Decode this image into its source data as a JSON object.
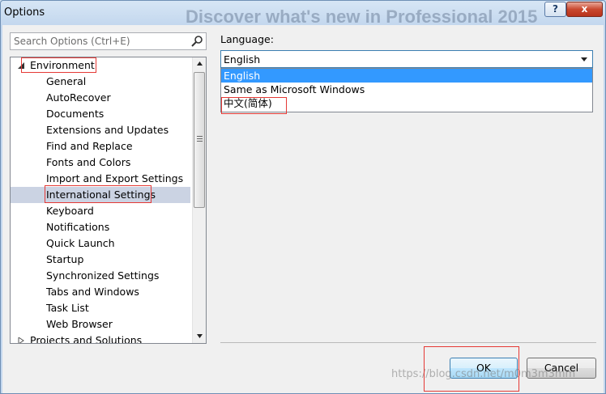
{
  "window": {
    "title": "Options",
    "background_headline": "Discover what's new in Professional 2015",
    "help_label": "?",
    "close_label": "x"
  },
  "search": {
    "placeholder": "Search Options (Ctrl+E)"
  },
  "tree": {
    "root": "Environment",
    "items": [
      "General",
      "AutoRecover",
      "Documents",
      "Extensions and Updates",
      "Find and Replace",
      "Fonts and Colors",
      "Import and Export Settings",
      "International Settings",
      "Keyboard",
      "Notifications",
      "Quick Launch",
      "Startup",
      "Synchronized Settings",
      "Tabs and Windows",
      "Task List",
      "Web Browser"
    ],
    "next_root": "Projects and Solutions",
    "selected": "International Settings"
  },
  "language": {
    "label": "Language:",
    "selected": "English",
    "options": [
      "English",
      "Same as Microsoft Windows",
      "中文(简体)"
    ]
  },
  "buttons": {
    "ok": "OK",
    "cancel": "Cancel"
  },
  "watermark": "https://blog.csdn.net/m0m3m3mm",
  "colors": {
    "highlight_box": "#e53935",
    "list_selected": "#3399ff",
    "tree_selected": "#cbd3e3"
  }
}
